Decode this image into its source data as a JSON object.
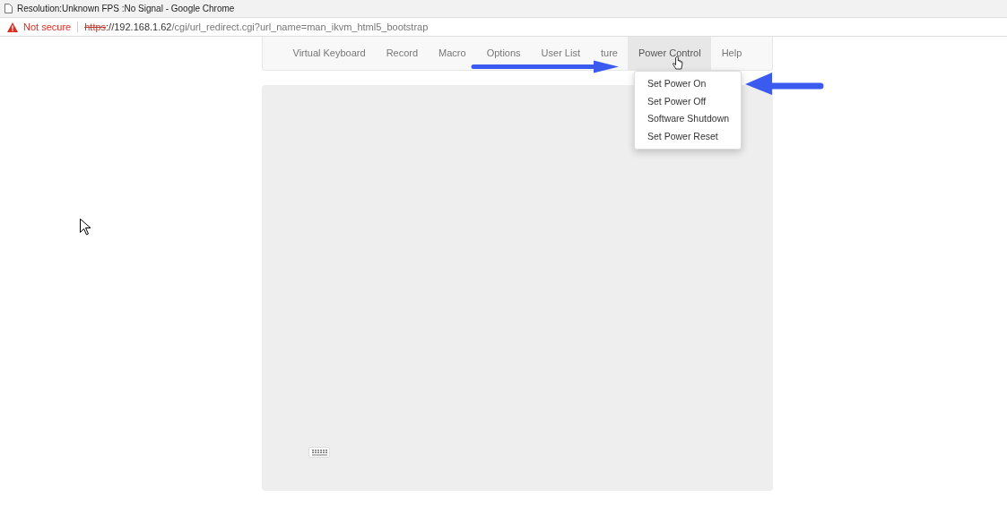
{
  "window": {
    "title": "Resolution:Unknown FPS :No Signal - Google Chrome"
  },
  "address_bar": {
    "security": "Not secure",
    "scheme": "https",
    "host": "://192.168.1.62",
    "path": "/cgi/url_redirect.cgi?url_name=man_ikvm_html5_bootstrap"
  },
  "nav": [
    {
      "label": "Virtual Keyboard",
      "selected": false
    },
    {
      "label": "Record",
      "selected": false
    },
    {
      "label": "Macro",
      "selected": false
    },
    {
      "label": "Options",
      "selected": false
    },
    {
      "label": "User List",
      "selected": false
    },
    {
      "label": "ture",
      "selected": false
    },
    {
      "label": "Power Control",
      "selected": true
    },
    {
      "label": "Help",
      "selected": false
    }
  ],
  "power_menu": [
    {
      "label": "Set Power On",
      "selected": false
    },
    {
      "label": "Set Power Off",
      "selected": false
    },
    {
      "label": "Software Shutdown",
      "selected": false
    },
    {
      "label": "Set Power Reset",
      "selected": false
    }
  ]
}
